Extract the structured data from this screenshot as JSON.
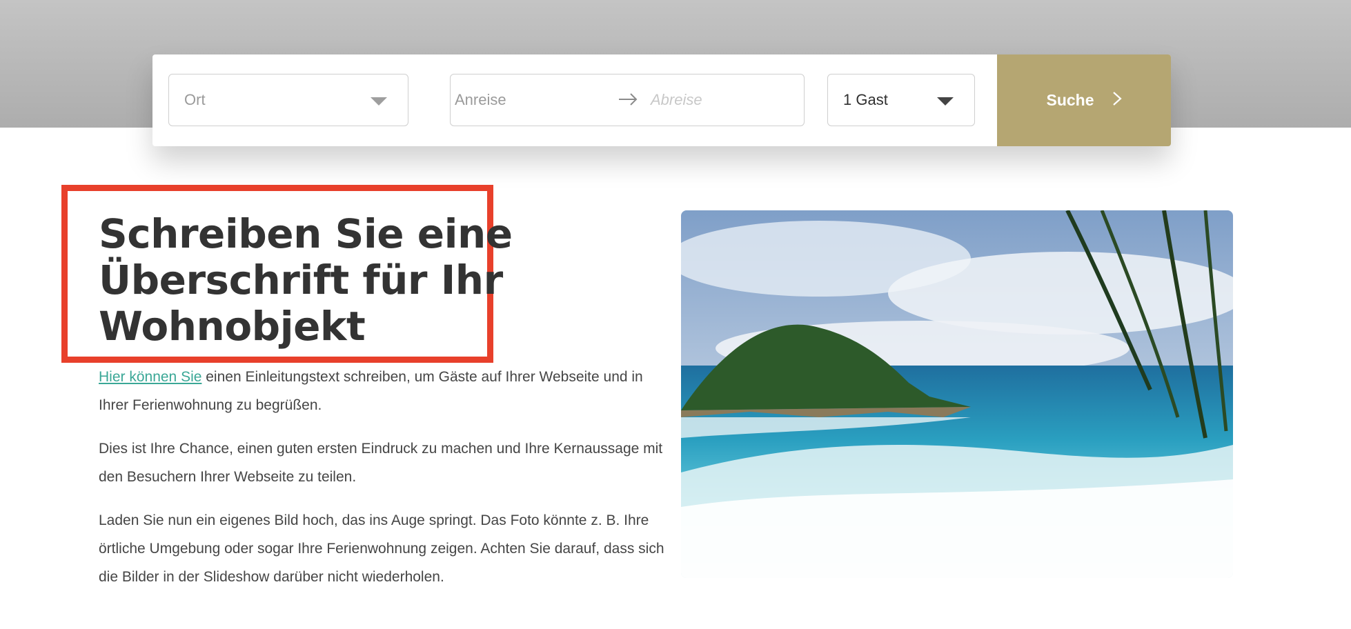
{
  "search": {
    "location_placeholder": "Ort",
    "arrival_placeholder": "Anreise",
    "departure_placeholder": "Abreise",
    "guests_value": "1 Gast",
    "submit_label": "Suche"
  },
  "content": {
    "heading": "Schreiben Sie eine Überschrift für Ihr Wohnobjekt",
    "intro_link": "Hier können Sie",
    "intro_rest": " einen Einleitungstext schreiben, um Gäste auf Ihrer Webseite und in Ihrer Ferienwohnung zu begrüßen.",
    "paragraph_2": "Dies ist Ihre Chance, einen guten ersten Eindruck zu machen und Ihre Kernaussage mit den Besuchern Ihrer Webseite zu teilen.",
    "paragraph_3": "Laden Sie nun ein eigenes Bild hoch, das ins Auge springt. Das Foto könnte z. B. Ihre örtliche Umgebung oder sogar Ihre Ferienwohnung zeigen. Achten Sie darauf, dass sich die Bilder in der Slideshow darüber nicht wiederholen."
  },
  "colors": {
    "accent_button": "#b5a672",
    "link": "#3aa796",
    "highlight_border": "#e8402b"
  }
}
